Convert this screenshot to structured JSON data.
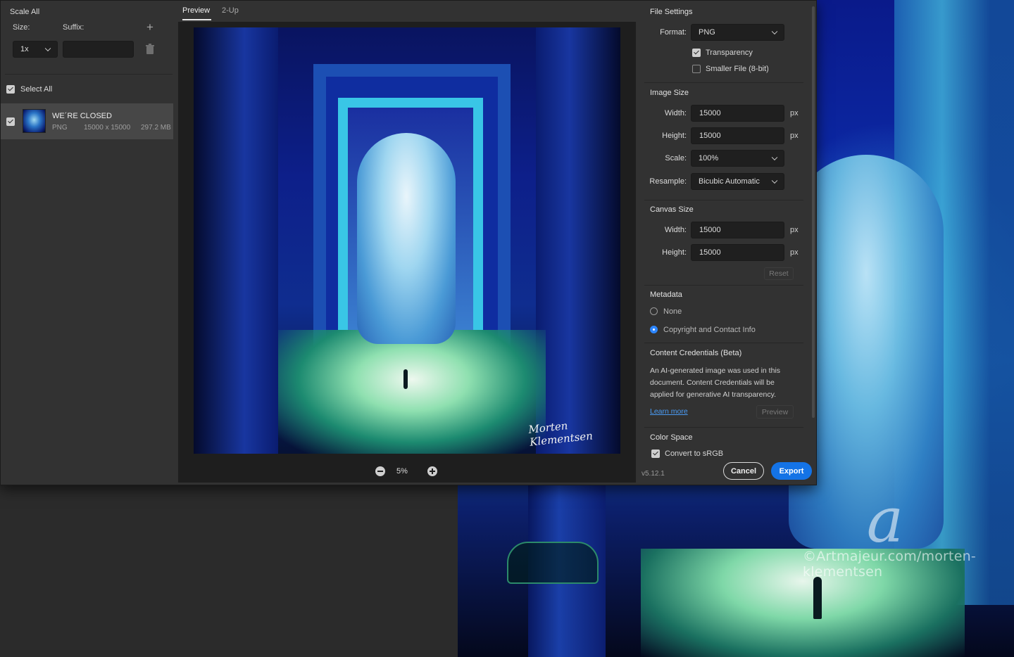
{
  "left_panel": {
    "scale_all": "Scale All",
    "size_label": "Size:",
    "suffix_label": "Suffix:",
    "size_value": "1x",
    "suffix_value": "",
    "select_all": "Select All",
    "asset": {
      "name": "WE´RE CLOSED",
      "format": "PNG",
      "dimensions": "15000 x 15000",
      "file_size": "297.2 MB"
    }
  },
  "preview": {
    "tabs": [
      "Preview",
      "2-Up"
    ],
    "active_tab": "Preview",
    "zoom": "5%",
    "signature": "Morten Klementsen"
  },
  "file_settings": {
    "title": "File Settings",
    "format_label": "Format:",
    "format_value": "PNG",
    "transparency": {
      "label": "Transparency",
      "checked": true
    },
    "smaller_file": {
      "label": "Smaller File (8-bit)",
      "checked": false
    }
  },
  "image_size": {
    "title": "Image Size",
    "width_label": "Width:",
    "width_value": "15000",
    "height_label": "Height:",
    "height_value": "15000",
    "scale_label": "Scale:",
    "scale_value": "100%",
    "resample_label": "Resample:",
    "resample_value": "Bicubic Automatic",
    "unit": "px"
  },
  "canvas_size": {
    "title": "Canvas Size",
    "width_label": "Width:",
    "width_value": "15000",
    "height_label": "Height:",
    "height_value": "15000",
    "unit": "px",
    "reset_label": "Reset"
  },
  "metadata": {
    "title": "Metadata",
    "options": [
      "None",
      "Copyright and Contact Info"
    ],
    "selected": "Copyright and Contact Info"
  },
  "content_credentials": {
    "title": "Content Credentials (Beta)",
    "lines": [
      "An AI-generated image was used in this",
      "document. Content Credentials will be",
      "applied for generative AI transparency."
    ],
    "learn_more": "Learn more",
    "preview_label": "Preview"
  },
  "color_space": {
    "title": "Color Space",
    "convert_label": "Convert to sRGB",
    "checked": true
  },
  "footer": {
    "version": "v5.12.1",
    "cancel": "Cancel",
    "export": "Export"
  },
  "watermark": {
    "logo": "a",
    "text": "©Artmajeur.com/morten-klementsen"
  },
  "colors": {
    "accent": "#1473e6",
    "dialog_bg": "#323232",
    "preview_bg": "#1e1e1e"
  }
}
